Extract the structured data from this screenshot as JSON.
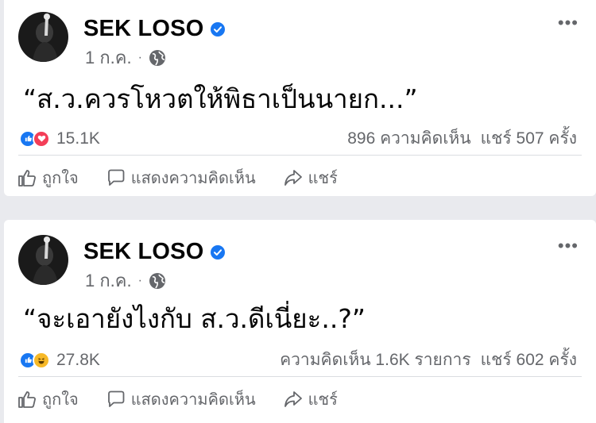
{
  "posts": [
    {
      "author": "SEK LOSO",
      "date": "1 ก.ค.",
      "separator": "·",
      "text": "“ส.ว.ควรโหวตให้พิธาเป็นนายก...”",
      "reaction_count": "15.1K",
      "comments": "896 ความคิดเห็น",
      "shares": "แชร์ 507 ครั้ง",
      "reactions": [
        "like-icon",
        "love-icon"
      ],
      "actions": {
        "like": "ถูกใจ",
        "comment": "แสดงความคิดเห็น",
        "share": "แชร์"
      }
    },
    {
      "author": "SEK LOSO",
      "date": "1 ก.ค.",
      "separator": "·",
      "text": "“จะเอายังไงกับ ส.ว.ดีเนี่ยะ..?”",
      "reaction_count": "27.8K",
      "comments": "ความคิดเห็น 1.6K รายการ",
      "shares": "แชร์ 602 ครั้ง",
      "reactions": [
        "like-icon",
        "haha-icon"
      ],
      "actions": {
        "like": "ถูกใจ",
        "comment": "แสดงความคิดเห็น",
        "share": "แชร์"
      }
    }
  ],
  "more_menu": "•••",
  "colors": {
    "background": "#e9eaee",
    "card": "#ffffff",
    "secondary_text": "#65676b",
    "like_blue": "#1877f2",
    "love_red": "#f33e58",
    "haha_yellow": "#f7b928"
  }
}
